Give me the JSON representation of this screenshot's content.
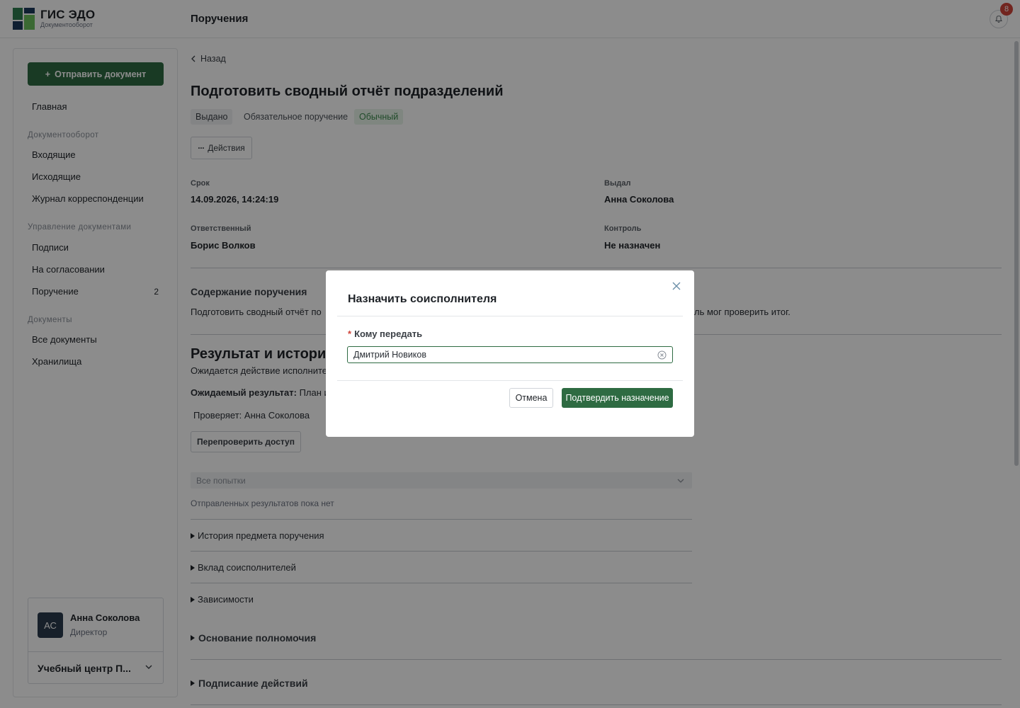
{
  "brand": {
    "title": "ГИС ЭДО",
    "subtitle": "Документооборот"
  },
  "header": {
    "page_title": "Поручения",
    "notification_count": "8"
  },
  "sidebar": {
    "send_button": "Отправить документ",
    "home": "Главная",
    "sections": [
      {
        "title": "Документооборот",
        "items": [
          "Входящие",
          "Исходящие",
          "Журнал корреспонденции"
        ]
      },
      {
        "title": "Управление документами",
        "items": [
          "Подписи",
          "На согласовании",
          "Поручение"
        ]
      },
      {
        "title": "Документы",
        "items": [
          "Все документы",
          "Хранилища"
        ]
      }
    ],
    "assignment_count": "2",
    "user": {
      "initials": "АС",
      "name": "Анна Соколова",
      "role": "Директор",
      "org": "Учебный центр П..."
    }
  },
  "main": {
    "back": "Назад",
    "title": "Подготовить сводный отчёт подразделений",
    "tags": {
      "status": "Выдано",
      "type": "Обязательное поручение",
      "priority": "Обычный"
    },
    "actions_button": "Действия",
    "fields": {
      "deadline_label": "Срок",
      "deadline_value": "14.09.2026, 14:24:19",
      "issuer_label": "Выдал",
      "issuer_value": "Анна Соколова",
      "responsible_label": "Ответственный",
      "responsible_value": "Борис Волков",
      "control_label": "Контроль",
      "control_value": "Не назначен"
    },
    "content_heading": "Содержание поручения",
    "content_text_left": "Подготовить сводный отчёт по",
    "content_text_right": "ль мог проверить итог.",
    "result_heading": "Результат и истори",
    "awaiting_text": "Ожидается действие исполните",
    "expected_label": "Ожидаемый результат:",
    "expected_value": "План и",
    "checker": "Проверяет: Анна Соколова",
    "recheck_button": "Перепроверить доступ",
    "attempts_select": "Все попытки",
    "no_results": "Отправленных результатов пока нет",
    "collapsibles": [
      "История предмета поручения",
      "Вклад соисполнителей",
      "Зависимости"
    ],
    "collapsible_heads": [
      "Основание полномочия",
      "Подписание действий"
    ]
  },
  "modal": {
    "title": "Назначить соисполнителя",
    "required_mark": "*",
    "field_label": "Кому передать",
    "field_value": "Дмитрий Новиков",
    "cancel": "Отмена",
    "confirm": "Подтвердить назначение"
  },
  "colors": {
    "accent": "#2e6b42",
    "badge": "#d0443a",
    "priority": "#3c8a4e"
  }
}
